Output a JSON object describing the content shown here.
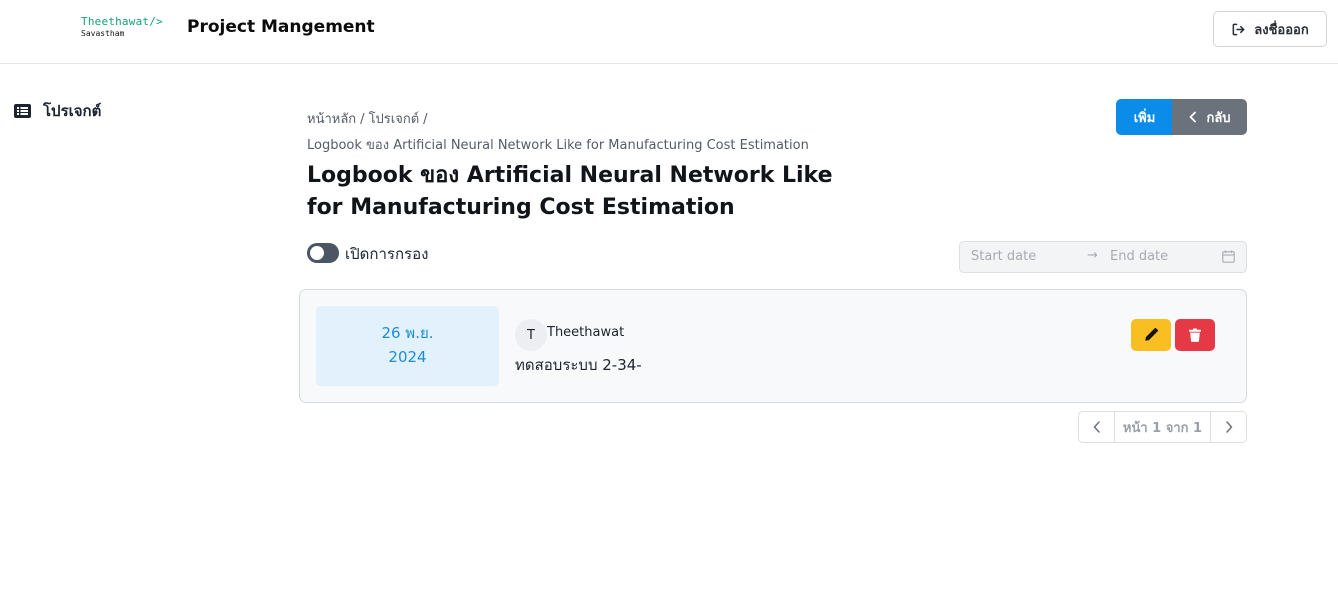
{
  "header": {
    "logo_top": "Theethawat/>",
    "logo_bottom": "Savastham",
    "app_title": "Project Mangement",
    "logout_label": "ลงชื่อออก",
    "logout_icon": "logout-icon"
  },
  "sidebar": {
    "items": [
      {
        "label": "โปรเจกต์",
        "icon": "list-icon"
      }
    ]
  },
  "main": {
    "breadcrumb": [
      "หน้าหลัก",
      "โปรเจกต์"
    ],
    "breadcrumb_sep": "/",
    "breadcrumb_current": "Logbook ของ Artificial Neural Network Like for Manufacturing Cost Estimation",
    "title": "Logbook ของ Artificial Neural Network Like for Manufacturing Cost Estimation",
    "add_label": "เพิ่ม",
    "back_label": "กลับ",
    "filter_label": "เปิดการกรอง",
    "filter_enabled": false,
    "date_start_placeholder": "Start date",
    "date_end_placeholder": "End date",
    "date_arrow": "→"
  },
  "entries": [
    {
      "day_month": "26 พ.ย.",
      "year": "2024",
      "avatar_initial": "T",
      "author": "Theethawat",
      "text": "ทดสอบระบบ 2-34-"
    }
  ],
  "pagination": {
    "info": "หน้า 1 จาก 1"
  },
  "colors": {
    "primary": "#0c8ce9",
    "secondary": "#6b727c",
    "edit": "#f9be22",
    "delete": "#e63946",
    "date_box_bg": "#e3f1fd",
    "date_box_text": "#1a8fd6",
    "logo_accent": "#13a37a"
  }
}
